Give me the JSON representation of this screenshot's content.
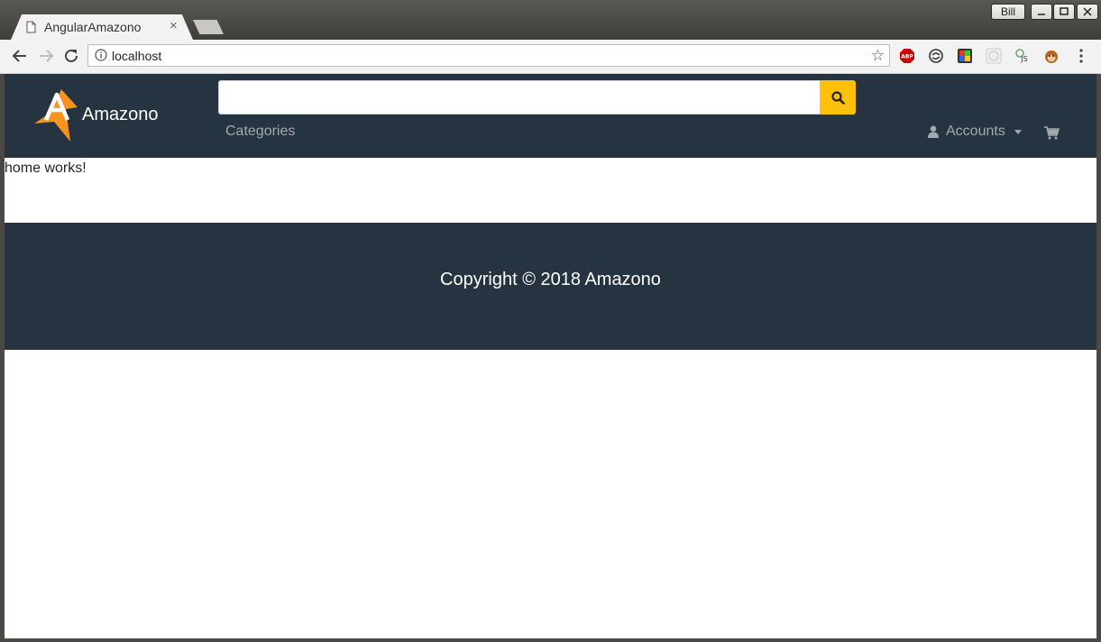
{
  "window": {
    "user_label": "Bill"
  },
  "tab": {
    "title": "AngularAmazono",
    "close_label": "×"
  },
  "toolbar": {
    "url": "localhost",
    "star": "☆"
  },
  "extensions": [
    {
      "name": "adblock-icon",
      "label": "ABP"
    },
    {
      "name": "sync-icon"
    },
    {
      "name": "color-picker-icon"
    },
    {
      "name": "grid-icon"
    },
    {
      "name": "js-icon",
      "label": "JS"
    },
    {
      "name": "monkey-icon"
    }
  ],
  "navbar": {
    "brand": "Amazono",
    "search_value": "",
    "categories": "Categories",
    "accounts": "Accounts"
  },
  "main": {
    "text": "home works!"
  },
  "footer": {
    "copyright": "Copyright © 2018 Amazono"
  },
  "colors": {
    "navbar_bg": "#263340",
    "search_button": "#ffc107",
    "logo_orange": "#f7941e"
  }
}
